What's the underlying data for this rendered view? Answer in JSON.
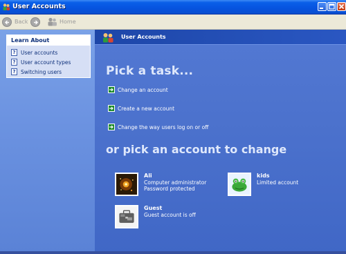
{
  "window": {
    "title": "User Accounts"
  },
  "toolbar": {
    "back_label": "Back",
    "home_label": "Home"
  },
  "learn_about": {
    "title": "Learn About",
    "items": [
      {
        "label": "User accounts"
      },
      {
        "label": "User account types"
      },
      {
        "label": "Switching users"
      }
    ]
  },
  "main": {
    "header_title": "User Accounts",
    "pick_task_title": "Pick a task...",
    "tasks": [
      {
        "label": "Change an account"
      },
      {
        "label": "Create a new account"
      },
      {
        "label": "Change the way users log on or off"
      }
    ],
    "pick_account_title": "or pick an account to change",
    "accounts": [
      {
        "name": "Ali",
        "line1": "Computer administrator",
        "line2": "Password protected"
      },
      {
        "name": "kids",
        "line1": "Limited account",
        "line2": ""
      },
      {
        "name": "Guest",
        "line1": "Guest account is off",
        "line2": ""
      }
    ]
  },
  "colors": {
    "title_bar": "#0653df",
    "main_bg": "#4c72cd",
    "task_arrow": "#1e8a2c"
  }
}
